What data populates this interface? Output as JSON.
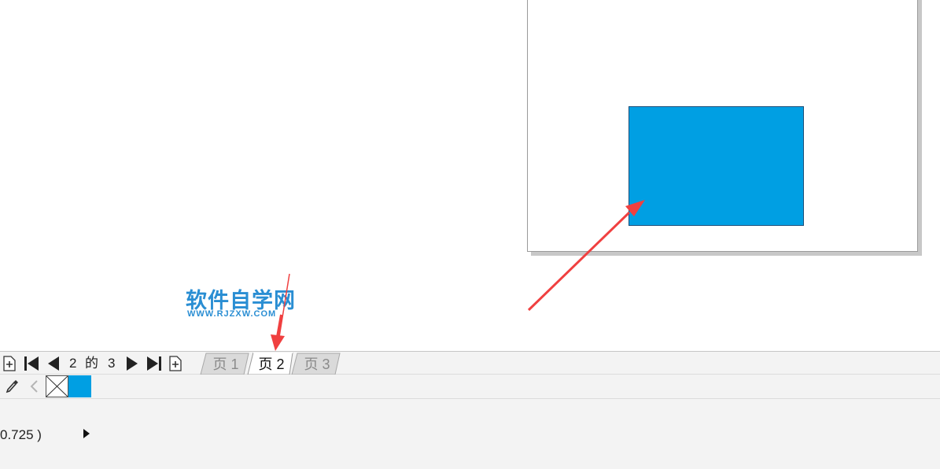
{
  "canvas": {
    "shape_fill_color": "#009fe3",
    "page_shadow_color": "#c8c8c8"
  },
  "watermark": {
    "title": "软件自学网",
    "url": "WWW.RJZXW.COM"
  },
  "page_navigator": {
    "current_page": "2",
    "of_label": "的",
    "total_pages": "3",
    "tabs": [
      {
        "label": "页 1",
        "active": false
      },
      {
        "label": "页 2",
        "active": true
      },
      {
        "label": "页 3",
        "active": false
      }
    ],
    "icons": [
      "add-page-before-icon",
      "first-page-icon",
      "previous-page-icon",
      "next-page-icon",
      "last-page-icon",
      "add-page-after-icon"
    ]
  },
  "palette": {
    "icons": [
      "eyedropper-icon",
      "scroll-left-icon"
    ],
    "swatches": [
      {
        "name": "no-fill",
        "color": "none"
      },
      {
        "name": "blue",
        "color": "#009fe3"
      }
    ]
  },
  "status_bar": {
    "text": "0.725 )",
    "expand_icon": "play-right-icon"
  },
  "annotation": {
    "arrow_color": "#f04040"
  }
}
